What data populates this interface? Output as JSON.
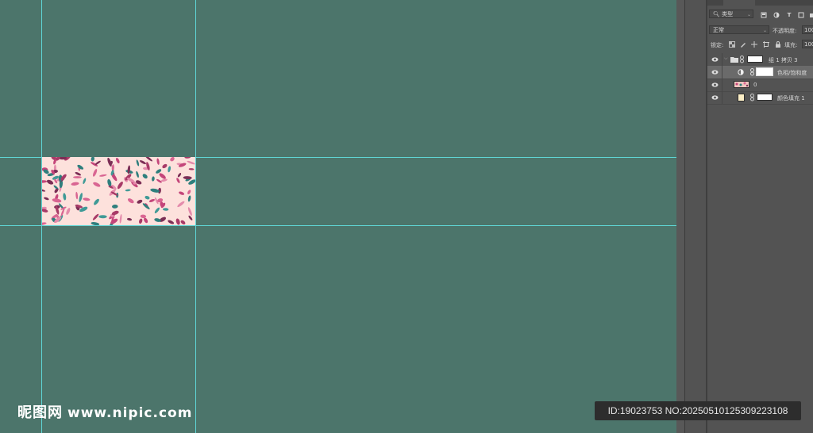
{
  "canvas": {
    "background": "#4c756b",
    "guide_color": "#5fd6d6"
  },
  "layers_panel": {
    "filter": {
      "kind_label": "类型",
      "icons": [
        "pixel-filter-icon",
        "adjustment-filter-icon",
        "type-filter-icon",
        "shape-filter-icon",
        "smart-object-filter-icon"
      ]
    },
    "blend_mode": "正常",
    "opacity_label": "不透明度:",
    "opacity_value": "100",
    "lock_label": "锁定:",
    "fill_label": "填充:",
    "fill_value": "100",
    "layers": [
      {
        "name": "组 1 拷贝 3",
        "type": "group",
        "visible": true,
        "selected": false
      },
      {
        "name": "色相/饱和度",
        "type": "adjustment",
        "visible": true,
        "selected": true
      },
      {
        "name": "0",
        "type": "pattern",
        "visible": true,
        "selected": false
      },
      {
        "name": "颜色填充 1",
        "type": "fill",
        "visible": true,
        "selected": false
      }
    ]
  },
  "watermark": {
    "logo": "昵图网",
    "site": "www.nipic.com",
    "id_text": "ID:19023753 NO:20250510125309223108"
  }
}
